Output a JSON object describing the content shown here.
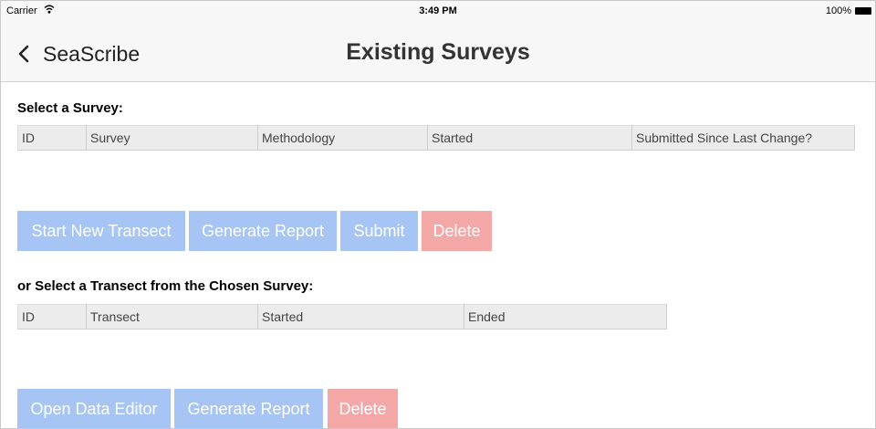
{
  "status_bar": {
    "carrier": "Carrier",
    "time": "3:49 PM",
    "battery": "100%"
  },
  "nav": {
    "back_label": "SeaScribe",
    "title": "Existing Surveys"
  },
  "survey_section": {
    "heading": "Select a Survey:",
    "columns": [
      "ID",
      "Survey",
      "Methodology",
      "Started",
      "Submitted Since Last Change?"
    ],
    "buttons": {
      "start_new_transect": "Start New Transect",
      "generate_report": "Generate Report",
      "submit": "Submit",
      "delete": "Delete"
    }
  },
  "transect_section": {
    "heading": "or Select a Transect from the Chosen Survey:",
    "columns": [
      "ID",
      "Transect",
      "Started",
      "Ended"
    ],
    "buttons": {
      "open_data_editor": "Open Data Editor",
      "generate_report": "Generate Report",
      "delete": "Delete"
    }
  },
  "colors": {
    "primary_button": "#a7c5f4",
    "danger_button": "#f3a7a7",
    "header_bg": "#ececec"
  }
}
